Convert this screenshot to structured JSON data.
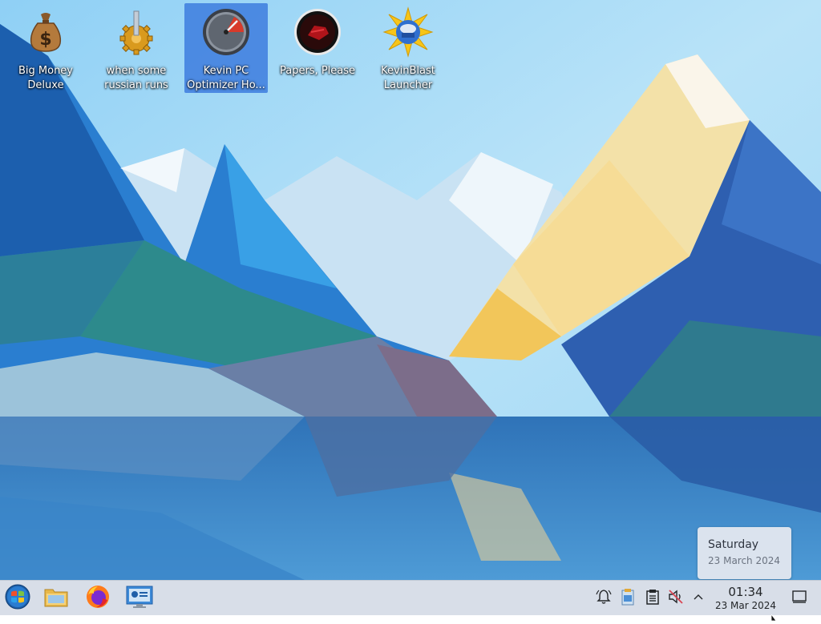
{
  "desktop": {
    "icons": [
      {
        "label": "Big Money Deluxe",
        "icon": "money-bag-icon"
      },
      {
        "label": "when some russian runs a...",
        "icon": "gear-icon"
      },
      {
        "label": "Kevin PC Optimizer Ho...",
        "icon": "gauge-icon",
        "selected": true
      },
      {
        "label": "Papers, Please",
        "icon": "papers-please-icon"
      },
      {
        "label": "KevinBlast Launcher",
        "icon": "blast-launcher-icon"
      }
    ]
  },
  "tooltip": {
    "weekday": "Saturday",
    "full_date": "23 March 2024"
  },
  "taskbar": {
    "launchers": [
      {
        "name": "start-menu",
        "icon": "windows-start-icon"
      },
      {
        "name": "file-manager",
        "icon": "folder-icon"
      },
      {
        "name": "firefox",
        "icon": "firefox-icon"
      },
      {
        "name": "system-settings",
        "icon": "settings-app-icon"
      }
    ],
    "tray": [
      {
        "name": "notifications",
        "icon": "bell-icon"
      },
      {
        "name": "clipboard-app",
        "icon": "clipboard-colored-icon"
      },
      {
        "name": "clipboard",
        "icon": "clipboard-icon"
      },
      {
        "name": "volume-muted",
        "icon": "speaker-muted-icon"
      },
      {
        "name": "expand-tray",
        "icon": "chevron-up-icon"
      }
    ],
    "clock": {
      "time": "01:34",
      "date": "23 Mar 2024"
    },
    "show_desktop_icon": "show-desktop-icon"
  },
  "colors": {
    "selection": "#3d7cde",
    "taskbar_bg": "#d8dee8",
    "sky": "#87c8f0"
  }
}
